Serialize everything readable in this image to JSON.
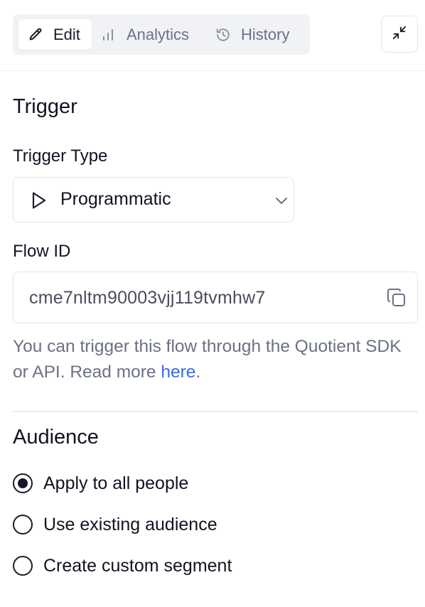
{
  "tabs": [
    {
      "label": "Edit",
      "icon": "pencil-icon",
      "active": true
    },
    {
      "label": "Analytics",
      "icon": "bar-chart-icon",
      "active": false
    },
    {
      "label": "History",
      "icon": "history-icon",
      "active": false
    }
  ],
  "collapse_icon": "minimize-icon",
  "trigger": {
    "heading": "Trigger",
    "type_label": "Trigger Type",
    "type_value": "Programmatic",
    "type_icon": "play-icon",
    "flow_id_label": "Flow ID",
    "flow_id_value": "cme7nltm90003vjj119tvmhw7",
    "help_text": "You can trigger this flow through the Quotient SDK or API. Read more ",
    "help_link": "here",
    "help_suffix": "."
  },
  "audience": {
    "heading": "Audience",
    "options": [
      {
        "label": "Apply to all people",
        "checked": true
      },
      {
        "label": "Use existing audience",
        "checked": false
      },
      {
        "label": "Create custom segment",
        "checked": false
      }
    ]
  },
  "colors": {
    "link": "#3b6ae0",
    "muted_text": "#6b7085",
    "tab_bar_bg": "#f1f2f6"
  }
}
